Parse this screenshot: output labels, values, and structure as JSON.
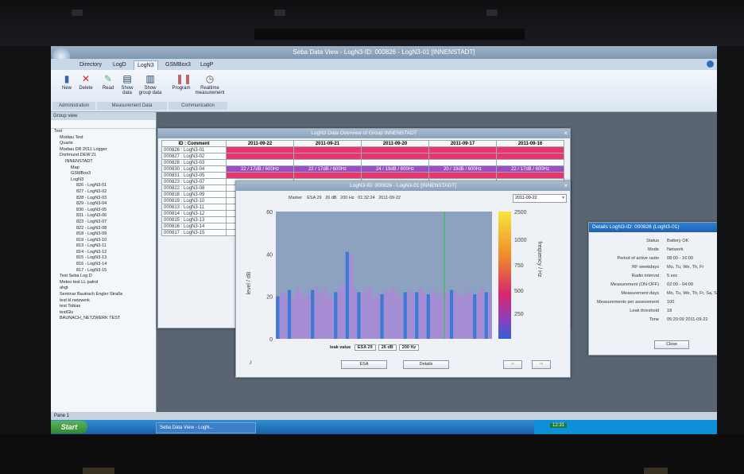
{
  "app": {
    "title": "Seba Data View - LogN3-ID: 000826 - LogN3-01 [INNENSTADT]",
    "ribbon_tabs": [
      "Directory",
      "LogD",
      "LogN3",
      "GSMBox3",
      "LogP"
    ],
    "active_tab": "LogN3",
    "ribbon_buttons": [
      {
        "label": "New",
        "icon": "phone-icon"
      },
      {
        "label": "Delete",
        "icon": "delete-icon"
      },
      {
        "label": "Read",
        "icon": "read-icon"
      },
      {
        "label": "Show data",
        "icon": "chart-icon"
      },
      {
        "label": "Show group data",
        "icon": "group-chart-icon"
      },
      {
        "label": "Program",
        "icon": "program-icon"
      },
      {
        "label": "Realtime measurement",
        "icon": "clock-icon"
      }
    ],
    "ribbon_groups": [
      "Administration",
      "Measurement Data",
      "Communication"
    ]
  },
  "group_view": {
    "title": "Group view",
    "tree": [
      "Test",
      "Modiau Test",
      "Quarte",
      "Modiau DR 2011 Logger",
      "Dortmund DEW 21",
      "INNENSTADT",
      "Map",
      "GSMBox3",
      "LogN3",
      "826 - LogN3-01",
      "827 - LogN3-02",
      "828 - LogN3-03",
      "829 - LogN3-04",
      "830 - LogN3-05",
      "831 - LogN3-06",
      "823 - LogN3-07",
      "822 - LogN3-08",
      "818 - LogN3-09",
      "819 - LogN3-10",
      "813 - LogN3-11",
      "814 - LogN3-12",
      "815 - LogN3-13",
      "816 - LogN3-14",
      "817 - LogN3-15",
      "Test Seba Log D",
      "Meteo test LL patrol",
      "ahgt",
      "Seminar Bautrach Engler Straße",
      "test kl.netzwerk",
      "test Tobias",
      "testGls",
      "BAUNACH_NETZWERK TEST"
    ]
  },
  "overview": {
    "title": "LogN3 Data Overview of Group INNENSTADT",
    "id_header": "ID : Comment",
    "dates": [
      "2011-09-22",
      "2011-09-21",
      "2011-09-20",
      "2011-09-17",
      "2011-09-16"
    ],
    "ids": [
      "000826 : LogN3-01",
      "000827 : LogN3-02",
      "000828 : LogN3-03",
      "000830 : LogN3-04",
      "000831 : LogN3-05",
      "000823 : LogN3-07",
      "000822 : LogN3-08",
      "000818 : LogN3-09",
      "000819 : LogN3-10",
      "000813 : LogN3-11",
      "000814 : LogN3-12",
      "000815 : LogN3-13",
      "000816 : LogN3-14",
      "000817 : LogN3-15"
    ],
    "row4_values": [
      "22 / 17dB / 600Hz",
      "22 / 17dB / 600Hz",
      "24 / 19dB / 600Hz",
      "20 / 19dB / 600Hz",
      "22 / 17dB / 600Hz"
    ]
  },
  "plot_window": {
    "title": "LogN3-ID: 000826 - LogN3-01 [INNENSTADT]",
    "marker_label": "Marker",
    "marker_values": [
      "ESA 29",
      "26 dB",
      "200 Hz",
      "01:32:24",
      "2011-09-22"
    ],
    "date_select": "2011-09-22",
    "ylabel": "level / dB",
    "zlabel": "frequency / Hz",
    "leak_value_label": "leak value",
    "leak_values": [
      "ESA 29",
      "26 dB",
      "200 Hz"
    ],
    "buttons": [
      "ESA",
      "Details"
    ],
    "y_ticks": [
      "60",
      "40",
      "20",
      "0"
    ],
    "colorbar_ticks": [
      "2500",
      "1000",
      "750",
      "500",
      "250"
    ]
  },
  "details": {
    "title": "Details LogN3-ID: 000826 (LogN3-01)",
    "rows": [
      {
        "label": "Status",
        "value": "Battery OK"
      },
      {
        "label": "Mode",
        "value": "Network"
      },
      {
        "label": "Period of active radio",
        "value": "08:00 - 16:00"
      },
      {
        "label": "RF weekdays",
        "value": "Mo, Tu, We, Th, Fr"
      },
      {
        "label": "Radio interval",
        "value": "5 sec"
      },
      {
        "label": "Measurement (ON-OFF)",
        "value": "02:00 - 04:00"
      },
      {
        "label": "Measurement days",
        "value": "Mo, Tu, We, Th, Fr, Sa, Su"
      },
      {
        "label": "Measurements per assessment",
        "value": "100"
      },
      {
        "label": "Leak threshold",
        "value": "18"
      },
      {
        "label": "Time",
        "value": "05:20:09 2011-09-22"
      }
    ],
    "close_label": "Close"
  },
  "status_bar": "Pane 1",
  "taskbar": {
    "start_label": "Start",
    "task_label": "Seba Data View - LogN...",
    "clock": "12:31"
  },
  "colors": {
    "pink": "#e8356f",
    "purple": "#9c4ec2",
    "bar": "#a98ad6",
    "bar_hi": "#3f78d6"
  },
  "chart_data": {
    "type": "bar",
    "ylabel": "level / dB",
    "ylim": [
      0,
      60
    ],
    "values": [
      20,
      22,
      21,
      23,
      19,
      24,
      22,
      20,
      21,
      23,
      25,
      22,
      24,
      21,
      20,
      22,
      23,
      26,
      41,
      40,
      24,
      22,
      21,
      23,
      24,
      20,
      22,
      21,
      23,
      22,
      24,
      21,
      20,
      22,
      23,
      21,
      22,
      24,
      22,
      21,
      23,
      22,
      20,
      22,
      21,
      23,
      22,
      21,
      20,
      22,
      23,
      21,
      22,
      24,
      22,
      21
    ]
  }
}
